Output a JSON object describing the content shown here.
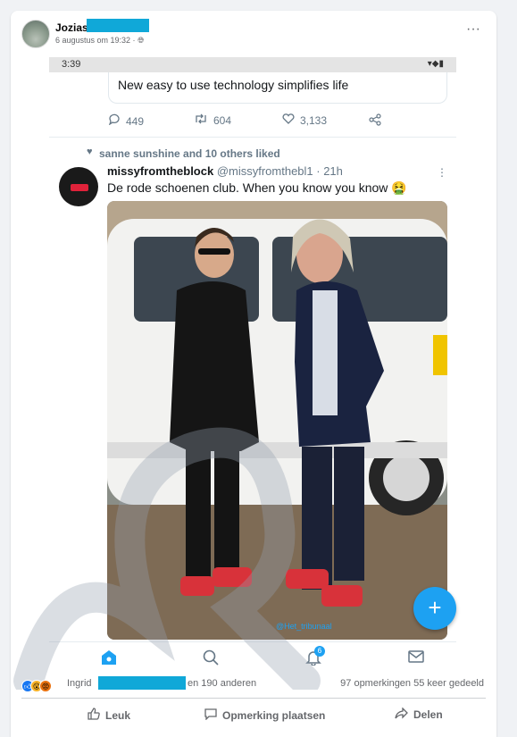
{
  "post": {
    "author": "Jozias",
    "meta": "6 augustus om 19:32 · ",
    "more": "···"
  },
  "screenshot": {
    "time": "3:39",
    "status_icons": "▾◆▮",
    "quoted_text": "New easy to use technology simplifies life",
    "actions": {
      "replies": "449",
      "retweets": "604",
      "likes": "3,133"
    },
    "liked_by": "sanne sunshine and 10 others liked",
    "tweet": {
      "display_name": "missyfromtheblock",
      "handle": " @missyfromthebl1 · 21h",
      "text": "De rode schoenen club. When you know you know 🤮",
      "more": "⋮"
    },
    "nav": {
      "notification_count": "6"
    },
    "watermark": "@Het_tribunaal",
    "fab": "+"
  },
  "reactions": {
    "names": "Ingrid",
    "others": "en 190 anderen",
    "counts": "97 opmerkingen  55 keer gedeeld"
  },
  "action_bar": {
    "like": "Leuk",
    "comment": "Opmerking plaatsen",
    "share": "Delen"
  },
  "colors": {
    "accent": "#1da1f2",
    "redaction": "#10a8d8",
    "facebook_blue": "#1877f2"
  }
}
